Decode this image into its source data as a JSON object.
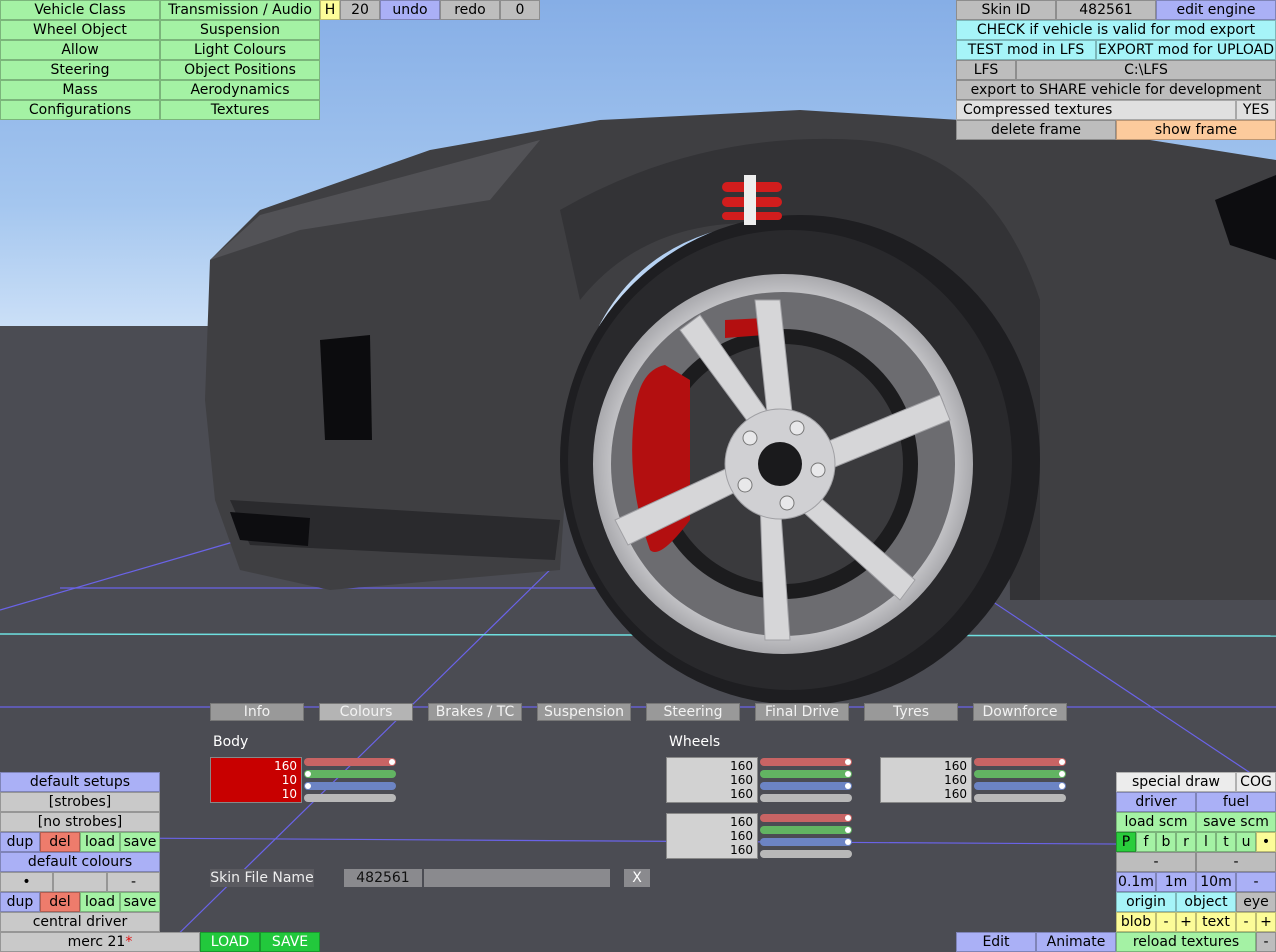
{
  "menu_left": [
    [
      "Vehicle Class",
      "Transmission / Audio"
    ],
    [
      "Wheel Object",
      "Suspension"
    ],
    [
      "Allow",
      "Light Colours"
    ],
    [
      "Steering",
      "Object Positions"
    ],
    [
      "Mass",
      "Aerodynamics"
    ],
    [
      "Configurations",
      "Textures"
    ]
  ],
  "toolbar": {
    "h": "H",
    "step": "20",
    "undo": "undo",
    "redo": "redo",
    "zero": "0"
  },
  "right_panel": {
    "skin_id_label": "Skin ID",
    "skin_id_value": "482561",
    "edit_engine": "edit engine",
    "check_valid": "CHECK if vehicle is valid for mod export",
    "test_mod": "TEST mod in LFS",
    "export_mod": "EXPORT mod for UPLOAD",
    "lfs_label": "LFS",
    "lfs_path": "C:\\LFS",
    "export_share": "export to SHARE vehicle for development",
    "compressed_label": "Compressed textures",
    "compressed_value": "YES",
    "delete_frame": "delete frame",
    "show_frame": "show frame"
  },
  "tabs": [
    "Info",
    "Colours",
    "Brakes / TC",
    "Suspension",
    "Steering",
    "Final Drive",
    "Tyres",
    "Downforce"
  ],
  "active_tab": "Colours",
  "colours": {
    "body_label": "Body",
    "wheels_label": "Wheels",
    "body": {
      "r": "160",
      "g": "10",
      "b": "10",
      "color": "#c80000"
    },
    "wheels_a": {
      "r": "160",
      "g": "160",
      "b": "160"
    },
    "wheels_b": {
      "r": "160",
      "g": "160",
      "b": "160"
    },
    "wheels_c": {
      "r": "160",
      "g": "160",
      "b": "160"
    }
  },
  "skin_file": {
    "label": "Skin File Name",
    "value": "482561",
    "clear": "X"
  },
  "left_bottom": {
    "default_setups": "default setups",
    "strobes": "[strobes]",
    "no_strobes": "[no strobes]",
    "dup": "dup",
    "del": "del",
    "load": "load",
    "save": "save",
    "default_colours": "default colours",
    "dot": "•",
    "dash": "-",
    "central_driver": "central driver",
    "car_name": "merc 21",
    "asterisk": "*",
    "load_caps": "LOAD",
    "save_caps": "SAVE"
  },
  "right_bottom": {
    "special_draw": "special draw",
    "cog": "COG",
    "driver": "driver",
    "fuel": "fuel",
    "load_scm": "load scm",
    "save_scm": "save scm",
    "letters": [
      "P",
      "f",
      "b",
      "r",
      "l",
      "t",
      "u",
      "•"
    ],
    "dash": "-",
    "dists": [
      "0.1m",
      "1m",
      "10m",
      "-"
    ],
    "origin": "origin",
    "object": "object",
    "eye": "eye",
    "blob": "blob",
    "minus": "-",
    "plus": "+",
    "text": "text",
    "edit": "Edit",
    "animate": "Animate",
    "reload_textures": "reload textures"
  }
}
